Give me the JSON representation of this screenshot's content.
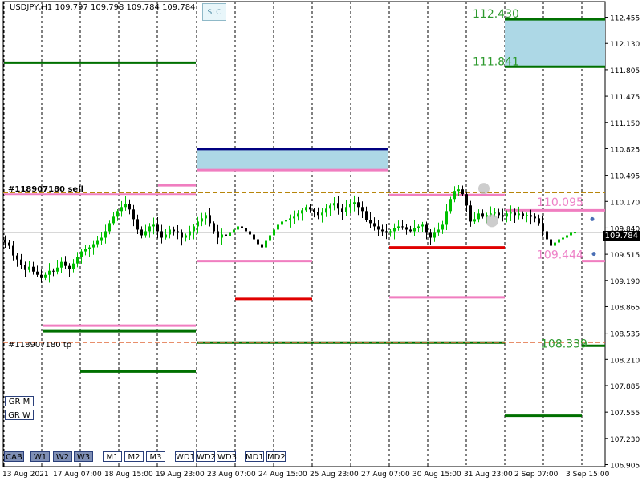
{
  "header": {
    "symbol_line": "USDJPY,H1  109.797 109.798 109.784 109.784"
  },
  "slc_button": "SLC",
  "order_labels": {
    "sell": "#118907180 sell",
    "tp": "#118907180 tp"
  },
  "price_labels": [
    {
      "text": "112.430",
      "price": 112.43,
      "x_index": 117,
      "color": "#2e9a2e"
    },
    {
      "text": "111.841",
      "price": 111.841,
      "x_index": 117,
      "color": "#2e9a2e"
    },
    {
      "text": "110.095",
      "price": 110.095,
      "x_index": 133,
      "color": "#ee82c8"
    },
    {
      "text": "109.444",
      "price": 109.444,
      "x_index": 133,
      "color": "#ee82c8"
    },
    {
      "text": "108.339",
      "price": 108.339,
      "x_index": 134,
      "color": "#2e9a2e"
    }
  ],
  "current_price": {
    "value": 109.784,
    "text": "109.784"
  },
  "side_buttons": [
    "GR M",
    "GR W"
  ],
  "bottom_buttons": [
    {
      "label": "CAB",
      "active": true
    },
    {
      "label": "W1",
      "active": true
    },
    {
      "label": "W2",
      "active": true
    },
    {
      "label": "W3",
      "active": true
    },
    {
      "label": "M1",
      "active": false
    },
    {
      "label": "M2",
      "active": false
    },
    {
      "label": "M3",
      "active": false
    },
    {
      "label": "WD1",
      "active": false
    },
    {
      "label": "WD2",
      "active": false
    },
    {
      "label": "WD3",
      "active": false
    },
    {
      "label": "MD1",
      "active": false
    },
    {
      "label": "MD2",
      "active": false
    }
  ],
  "colors": {
    "green": "#007000",
    "pink": "#f07ec0",
    "red": "#e00000",
    "navy": "#000080",
    "box_fill": "#add8e6",
    "candle_up": "#00c000",
    "candle_down": "#000000",
    "dash_gold": "#b8860b",
    "tp_dash": "#e06a3a"
  },
  "chart_data": {
    "type": "candlestick",
    "title": "USDJPY,H1",
    "y_range": [
      106.9,
      112.57
    ],
    "y_ticks": [
      "112.455",
      "112.130",
      "111.805",
      "111.475",
      "111.150",
      "110.825",
      "110.495",
      "110.170",
      "109.840",
      "109.515",
      "109.190",
      "108.865",
      "108.535",
      "108.210",
      "107.885",
      "107.555",
      "107.230",
      "106.905"
    ],
    "x_ticks": [
      "13 Aug 2021",
      "17 Aug 07:00",
      "18 Aug 15:00",
      "19 Aug 23:00",
      "23 Aug 07:00",
      "24 Aug 15:00",
      "25 Aug 23:00",
      "27 Aug 07:00",
      "30 Aug 15:00",
      "31 Aug 23:00",
      "2 Sep 07:00",
      "3 Sep 15:00"
    ],
    "x_range": [
      0,
      150
    ],
    "close": [
      109.66,
      109.62,
      109.5,
      109.45,
      109.38,
      109.32,
      109.36,
      109.3,
      109.26,
      109.22,
      109.26,
      109.31,
      109.3,
      109.35,
      109.42,
      109.37,
      109.33,
      109.4,
      109.48,
      109.55,
      109.58,
      109.6,
      109.64,
      109.68,
      109.72,
      109.8,
      109.9,
      109.98,
      110.05,
      110.1,
      110.14,
      110.07,
      109.95,
      109.82,
      109.75,
      109.8,
      109.86,
      109.88,
      109.8,
      109.72,
      109.76,
      109.82,
      109.8,
      109.78,
      109.72,
      109.75,
      109.8,
      109.86,
      109.92,
      109.96,
      110.0,
      109.9,
      109.8,
      109.72,
      109.76,
      109.74,
      109.78,
      109.82,
      109.86,
      109.84,
      109.8,
      109.76,
      109.7,
      109.64,
      109.6,
      109.68,
      109.75,
      109.82,
      109.88,
      109.92,
      109.94,
      109.96,
      109.98,
      110.02,
      110.06,
      110.1,
      110.07,
      110.04,
      110.0,
      110.03,
      110.08,
      110.12,
      110.15,
      110.08,
      110.04,
      110.1,
      110.14,
      110.16,
      110.1,
      110.05,
      109.94,
      109.9,
      109.86,
      109.82,
      109.8,
      109.78,
      109.8,
      109.84,
      109.86,
      109.85,
      109.82,
      109.8,
      109.84,
      109.86,
      109.88,
      109.78,
      109.72,
      109.78,
      109.82,
      109.88,
      110.05,
      110.2,
      110.3,
      110.32,
      110.26,
      110.12,
      109.92,
      109.95,
      110.02,
      109.98,
      110.0,
      110.02,
      110.03,
      110.0,
      109.98,
      110.02,
      110.03,
      110.0,
      110.02,
      109.99,
      110.0,
      109.98,
      109.96,
      109.9,
      109.8,
      109.7,
      109.62,
      109.66,
      109.7,
      109.72,
      109.75,
      109.78,
      109.784
    ]
  }
}
